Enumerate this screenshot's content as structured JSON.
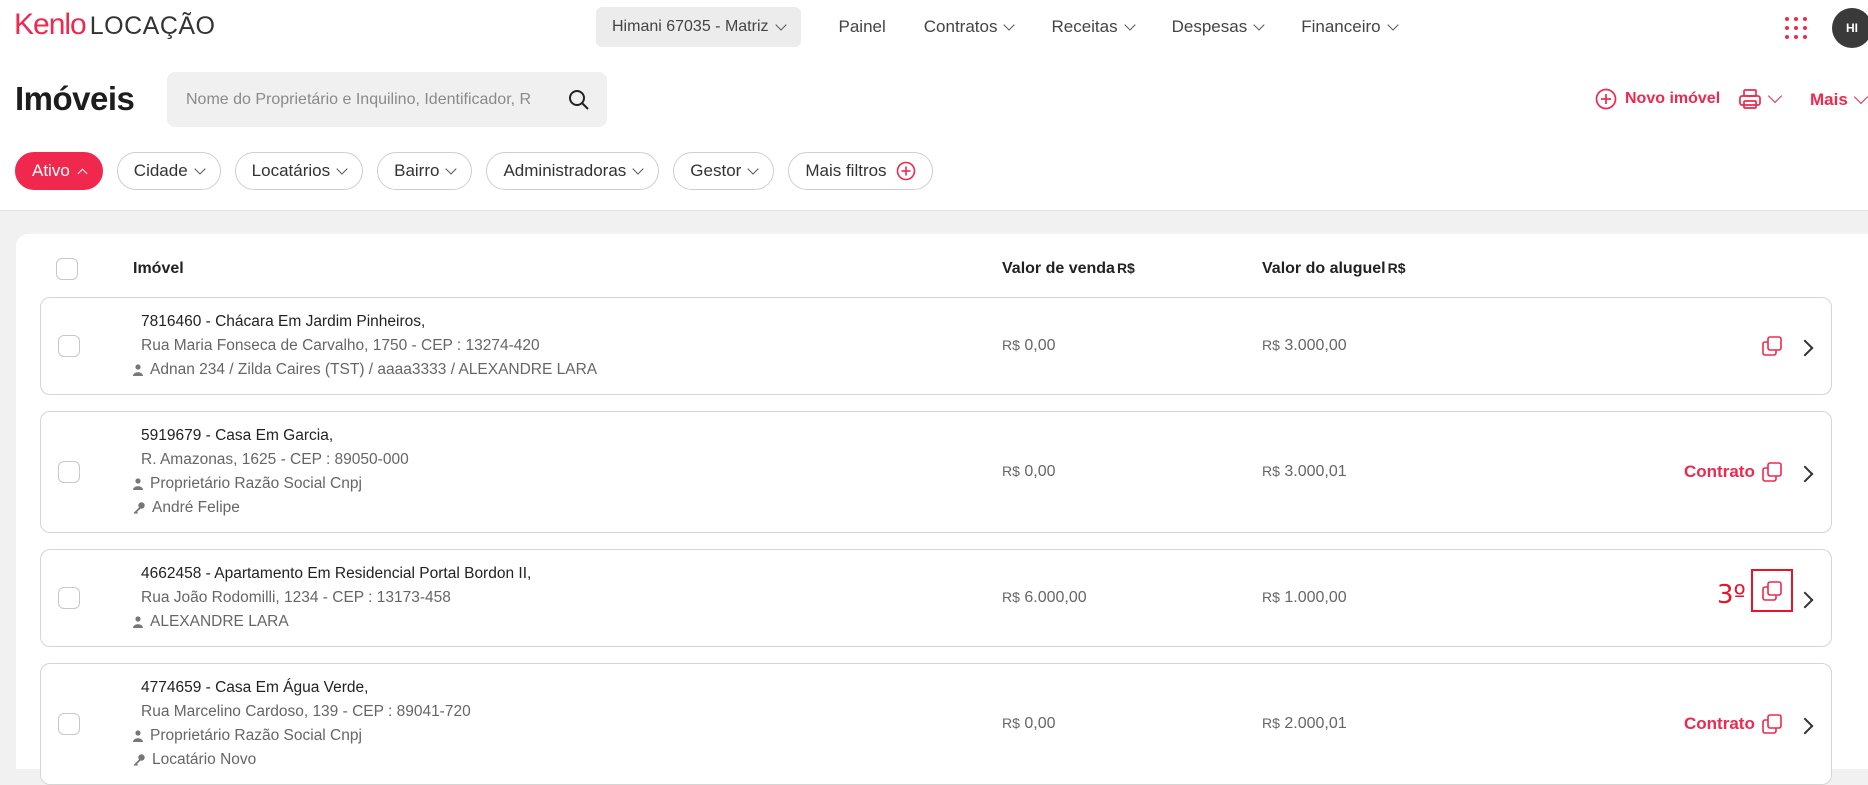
{
  "header": {
    "logo_brand": "Kenlo",
    "logo_sub": "LOCAÇÃO",
    "branch": "Himani 67035 - Matriz",
    "nav": [
      "Painel",
      "Contratos",
      "Receitas",
      "Despesas",
      "Financeiro"
    ],
    "avatar_initials": "HI"
  },
  "page": {
    "title": "Imóveis",
    "search_placeholder": "Nome do Proprietário e Inquilino, Identificador, R",
    "new_property": "Novo imóvel",
    "more": "Mais"
  },
  "filters": {
    "active": "Ativo",
    "city": "Cidade",
    "tenants": "Locatários",
    "district": "Bairro",
    "administrators": "Administradoras",
    "manager": "Gestor",
    "more_filters": "Mais filtros"
  },
  "table": {
    "col_property": "Imóvel",
    "col_sale": "Valor de venda",
    "col_rent": "Valor do aluguel",
    "currency": "R$"
  },
  "rows": [
    {
      "title": "7816460 - Chácara Em Jardim Pinheiros,",
      "address": "Rua Maria Fonseca de Carvalho, 1750 - CEP : 13274-420",
      "owner": "Adnan 234 / Zilda Caires (TST) / aaaa3333 / ALEXANDRE LARA",
      "sale": "0,00",
      "rent": "3.000,00"
    },
    {
      "title": "5919679 - Casa Em Garcia,",
      "address": "R. Amazonas, 1625 - CEP : 89050-000",
      "owner": "Proprietário Razão Social Cnpj",
      "tenant": "André Felipe",
      "sale": "0,00",
      "rent": "3.000,01",
      "contract": "Contrato"
    },
    {
      "title": "4662458 - Apartamento Em Residencial Portal Bordon II,",
      "address": "Rua João Rodomilli, 1234 - CEP : 13173-458",
      "owner": "ALEXANDRE LARA",
      "sale": "6.000,00",
      "rent": "1.000,00",
      "annotation": "3º"
    },
    {
      "title": "4774659 - Casa Em Água Verde,",
      "address": "Rua Marcelino Cardoso, 139 - CEP : 89041-720",
      "owner": "Proprietário Razão Social Cnpj",
      "tenant": "Locatário Novo",
      "sale": "0,00",
      "rent": "2.000,01",
      "contract": "Contrato"
    }
  ],
  "colors": {
    "brand": "#f0284e",
    "annotation": "#e8132b"
  }
}
